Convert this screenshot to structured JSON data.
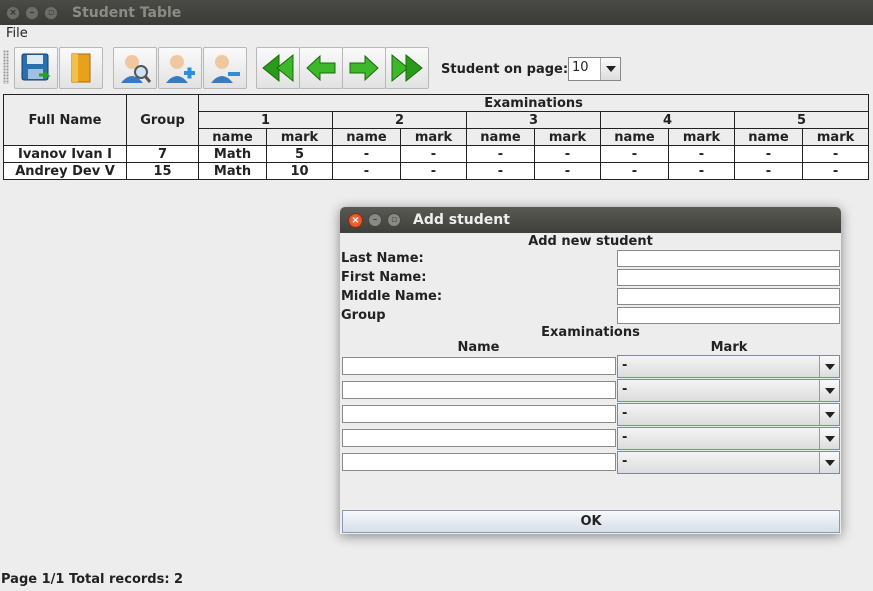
{
  "window": {
    "title": "Student Table"
  },
  "menu": {
    "file": "File"
  },
  "toolbar": {
    "buttons": [
      {
        "name": "save-icon"
      },
      {
        "name": "open-book-icon"
      },
      {
        "name": "search-student-icon"
      },
      {
        "name": "add-student-icon"
      },
      {
        "name": "remove-student-icon"
      },
      {
        "name": "first-page-icon"
      },
      {
        "name": "prev-page-icon"
      },
      {
        "name": "next-page-icon"
      },
      {
        "name": "last-page-icon"
      }
    ],
    "students_per_page_label": "Student on page:",
    "students_per_page_value": "10"
  },
  "table": {
    "col_fullname": "Full Name",
    "col_group": "Group",
    "col_exams": "Examinations",
    "exam_numbers": [
      "1",
      "2",
      "3",
      "4",
      "5"
    ],
    "sub_name": "name",
    "sub_mark": "mark",
    "rows": [
      {
        "full_name": "Ivanov Ivan I",
        "group": "7",
        "exams": [
          [
            "Math",
            "5"
          ],
          [
            "-",
            "-"
          ],
          [
            "-",
            "-"
          ],
          [
            "-",
            "-"
          ],
          [
            "-",
            "-"
          ]
        ]
      },
      {
        "full_name": "Andrey Dev V",
        "group": "15",
        "exams": [
          [
            "Math",
            "10"
          ],
          [
            "-",
            "-"
          ],
          [
            "-",
            "-"
          ],
          [
            "-",
            "-"
          ],
          [
            "-",
            "-"
          ]
        ]
      }
    ]
  },
  "status": "Page 1/1 Total records: 2",
  "dialog": {
    "title": "Add student",
    "heading": "Add new student",
    "last_name_label": "Last Name:",
    "first_name_label": "First Name:",
    "middle_name_label": "Middle Name:",
    "group_label": "Group",
    "exams_heading": "Examinations",
    "col_name": "Name",
    "col_mark": "Mark",
    "exam_rows": [
      {
        "name": "",
        "mark": "-"
      },
      {
        "name": "",
        "mark": "-"
      },
      {
        "name": "",
        "mark": "-"
      },
      {
        "name": "",
        "mark": "-"
      },
      {
        "name": "",
        "mark": "-"
      }
    ],
    "ok": "OK"
  }
}
